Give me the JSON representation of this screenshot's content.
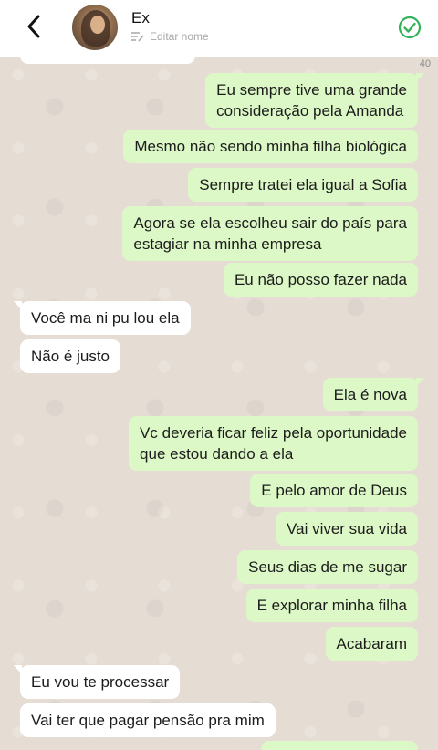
{
  "header": {
    "contact_name": "Ex",
    "edit_label": "Editar nome"
  },
  "chat": {
    "message_count": "40",
    "messages": [
      {
        "dir": "out",
        "lines": [
          "Eu sempre tive uma grande",
          "consideração pela Amanda"
        ]
      },
      {
        "dir": "out",
        "lines": [
          "Mesmo não sendo minha filha biológica"
        ]
      },
      {
        "dir": "out",
        "lines": [
          "Sempre tratei ela igual a Sofia"
        ]
      },
      {
        "dir": "out",
        "lines": [
          "Agora se ela escolheu sair do país para",
          "estagiar na minha empresa"
        ]
      },
      {
        "dir": "out",
        "lines": [
          "Eu não posso fazer nada"
        ]
      },
      {
        "dir": "in",
        "lines": [
          "Você ma ni pu lou ela"
        ]
      },
      {
        "dir": "in",
        "lines": [
          "Não é justo"
        ]
      },
      {
        "dir": "out",
        "lines": [
          "Ela é nova"
        ]
      },
      {
        "dir": "out",
        "lines": [
          "Vc deveria ficar feliz pela oportunidade",
          "que estou dando a ela"
        ]
      },
      {
        "dir": "out",
        "lines": [
          "E pelo amor de Deus"
        ]
      },
      {
        "dir": "out",
        "lines": [
          "Vai viver sua vida"
        ]
      },
      {
        "dir": "out",
        "lines": [
          "Seus dias de me sugar"
        ]
      },
      {
        "dir": "out",
        "lines": [
          "E explorar minha filha"
        ]
      },
      {
        "dir": "out",
        "lines": [
          "Acabaram"
        ]
      },
      {
        "dir": "in",
        "lines": [
          "Eu vou te processar"
        ]
      },
      {
        "dir": "in",
        "lines": [
          "Vai ter que pagar pensão pra mim"
        ]
      }
    ]
  },
  "colors": {
    "outgoing_bubble": "#dcf8c6",
    "incoming_bubble": "#ffffff",
    "chat_background": "#e5ddd4",
    "accent_check": "#34b35a"
  },
  "icons": {
    "back": "chevron-left-icon",
    "edit": "edit-lines-icon",
    "confirm": "check-circle-icon"
  }
}
